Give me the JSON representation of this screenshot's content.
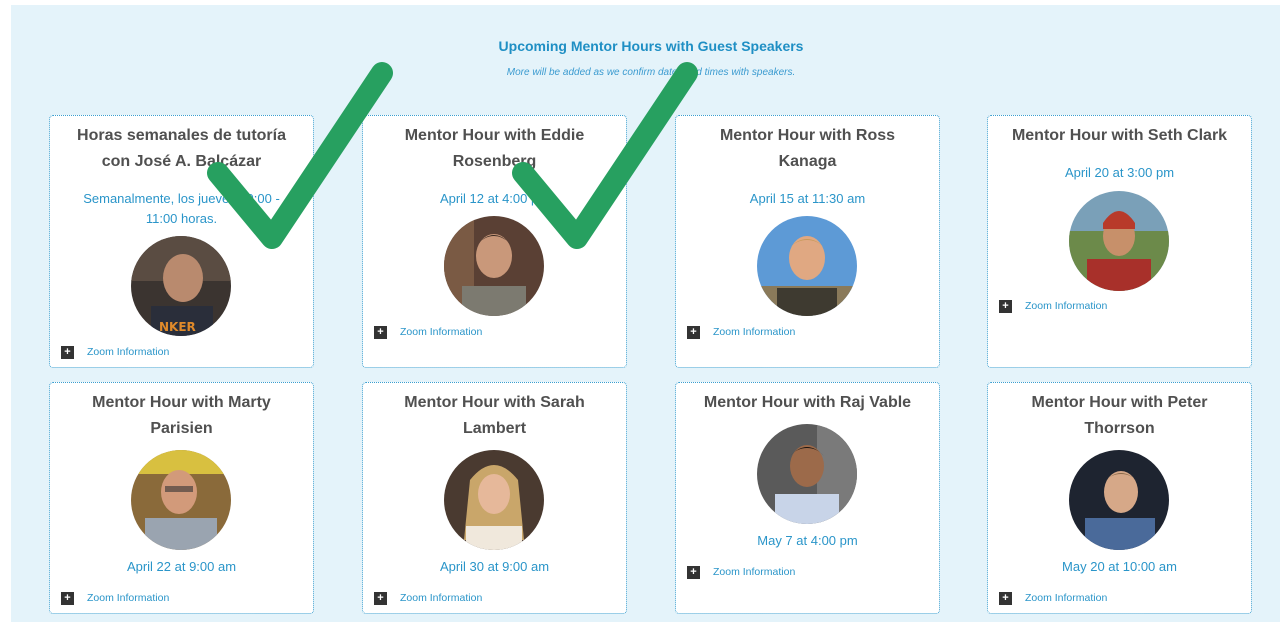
{
  "header": {
    "title": "Upcoming Mentor Hours with Guest Speakers",
    "subtitle": "More will be added as we confirm dates and times with speakers."
  },
  "zoom_label": "Zoom Information",
  "cards": [
    {
      "title_line1": "Horas semanales de tutoría",
      "title_line2": "con José A. Balcázar",
      "date_line1": "Semanalmente, los jueves 10:00 -",
      "date_line2": "11:00 horas.",
      "checked": true
    },
    {
      "title_line1": "Mentor Hour with Eddie",
      "title_line2": "Rosenberg",
      "date_line1": "April 12 at 4:00 pm",
      "checked": true
    },
    {
      "title_line1": "Mentor Hour with Ross",
      "title_line2": "Kanaga",
      "date_line1": "April 15 at 11:30 am"
    },
    {
      "title_line1": "Mentor Hour with Seth Clark",
      "date_line1": "April 20 at 3:00 pm"
    },
    {
      "title_line1": "Mentor Hour with Marty",
      "title_line2": "Parisien",
      "date_line1": "April 22 at 9:00 am"
    },
    {
      "title_line1": "Mentor Hour with Sarah",
      "title_line2": "Lambert",
      "date_line1": "April 30 at 9:00 am"
    },
    {
      "title_line1": "Mentor Hour with Raj Vable",
      "date_line1": "May 7 at 4:00 pm"
    },
    {
      "title_line1": "Mentor Hour with Peter",
      "title_line2": "Thorrson",
      "date_line1": "May 20 at 10:00 am"
    }
  ],
  "check_color": "#27a060"
}
